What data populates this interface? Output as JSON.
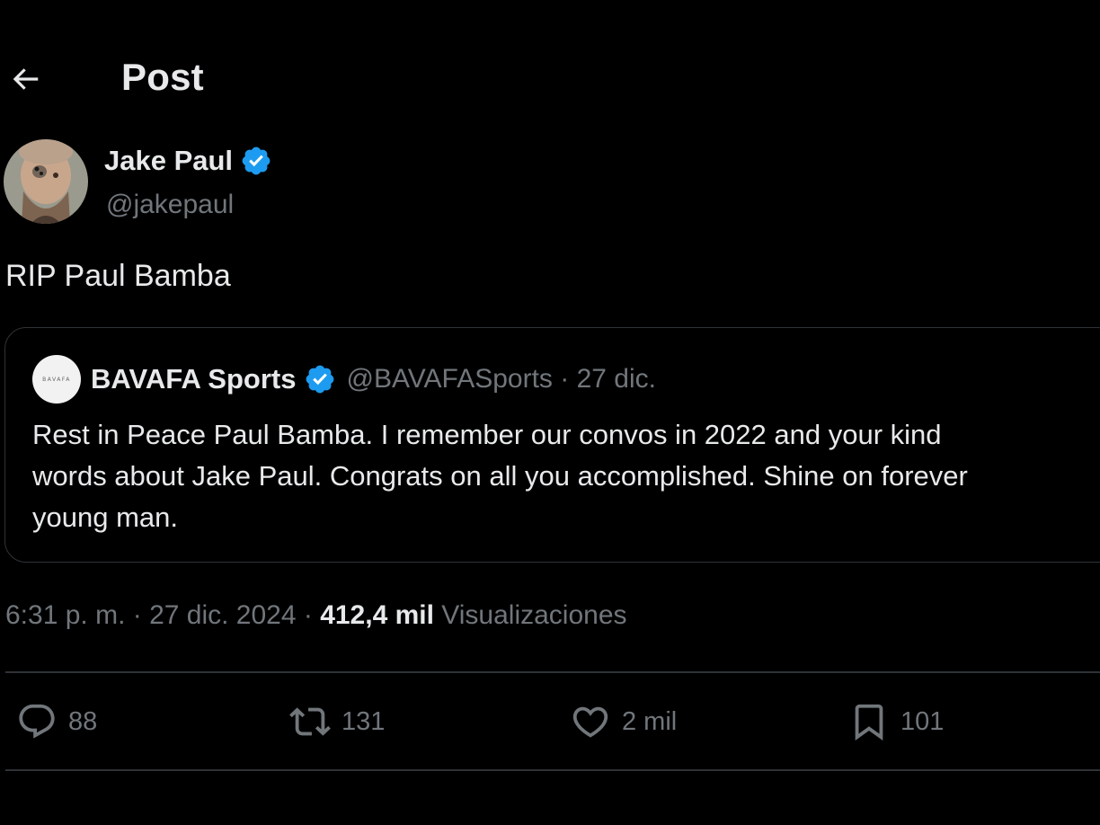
{
  "header": {
    "title": "Post",
    "back_icon": "arrow-left-icon"
  },
  "author": {
    "name": "Jake Paul",
    "handle": "@jakepaul",
    "verified": true
  },
  "tweet": {
    "text": "RIP Paul Bamba"
  },
  "quote": {
    "avatar_text": "BAVAFA",
    "name": "BAVAFA Sports",
    "verified": true,
    "meta": "@BAVAFASports · 27 dic.",
    "lines": [
      "Rest in Peace Paul Bamba. I remember our convos in 2022 and your kind",
      "words about Jake Paul. Congrats on all you accomplished. Shine on forever",
      "young man."
    ]
  },
  "meta": {
    "time_date": "6:31 p. m. · 27 dic. 2024 · ",
    "views_count": "412,4 mil",
    "views_label": " Visualizaciones"
  },
  "actions": {
    "replies": "88",
    "reposts": "131",
    "likes": "2 mil",
    "bookmarks": "101"
  },
  "colors": {
    "background": "#000000",
    "text": "#e7e9ea",
    "muted": "#71767b",
    "border": "#2f3336",
    "verified": "#1d9bf0"
  }
}
